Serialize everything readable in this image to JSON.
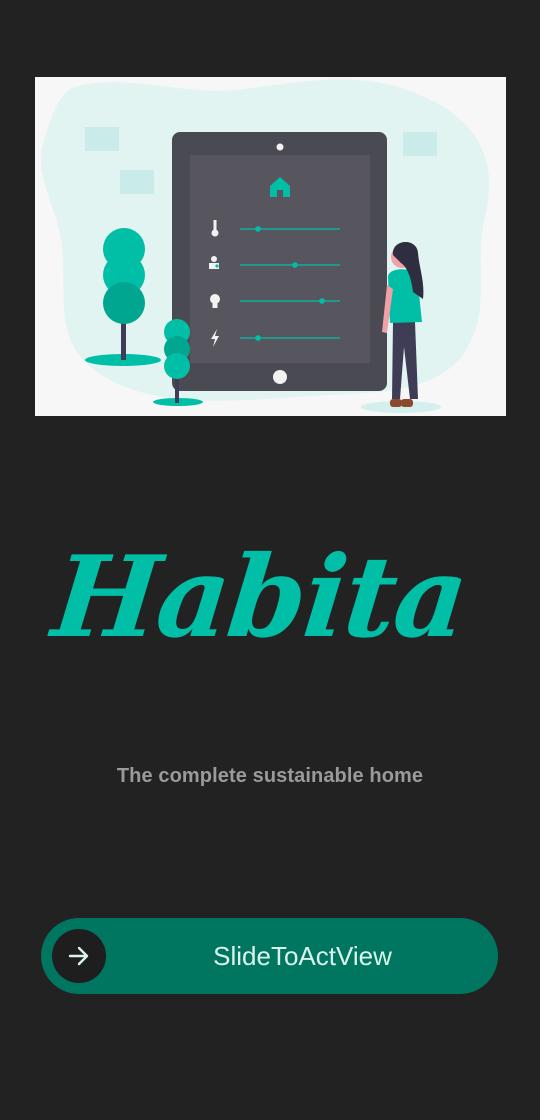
{
  "app": {
    "name": "Habita",
    "tagline": "The complete sustainable home"
  },
  "hero": {
    "illustration": "smart-home-tablet-illustration",
    "controls": [
      {
        "icon": "thermometer-icon",
        "level": 0.18
      },
      {
        "icon": "faucet-icon",
        "level": 0.55
      },
      {
        "icon": "lightbulb-icon",
        "level": 0.82
      },
      {
        "icon": "lightning-icon",
        "level": 0.18
      }
    ]
  },
  "slider": {
    "label": "SlideToActView",
    "icon": "arrow-right-icon"
  },
  "colors": {
    "background": "#222222",
    "accent": "#00bfa6",
    "slider_track": "#00755f",
    "slider_knob": "#1e1e1e",
    "tagline": "#9a9a9a"
  }
}
